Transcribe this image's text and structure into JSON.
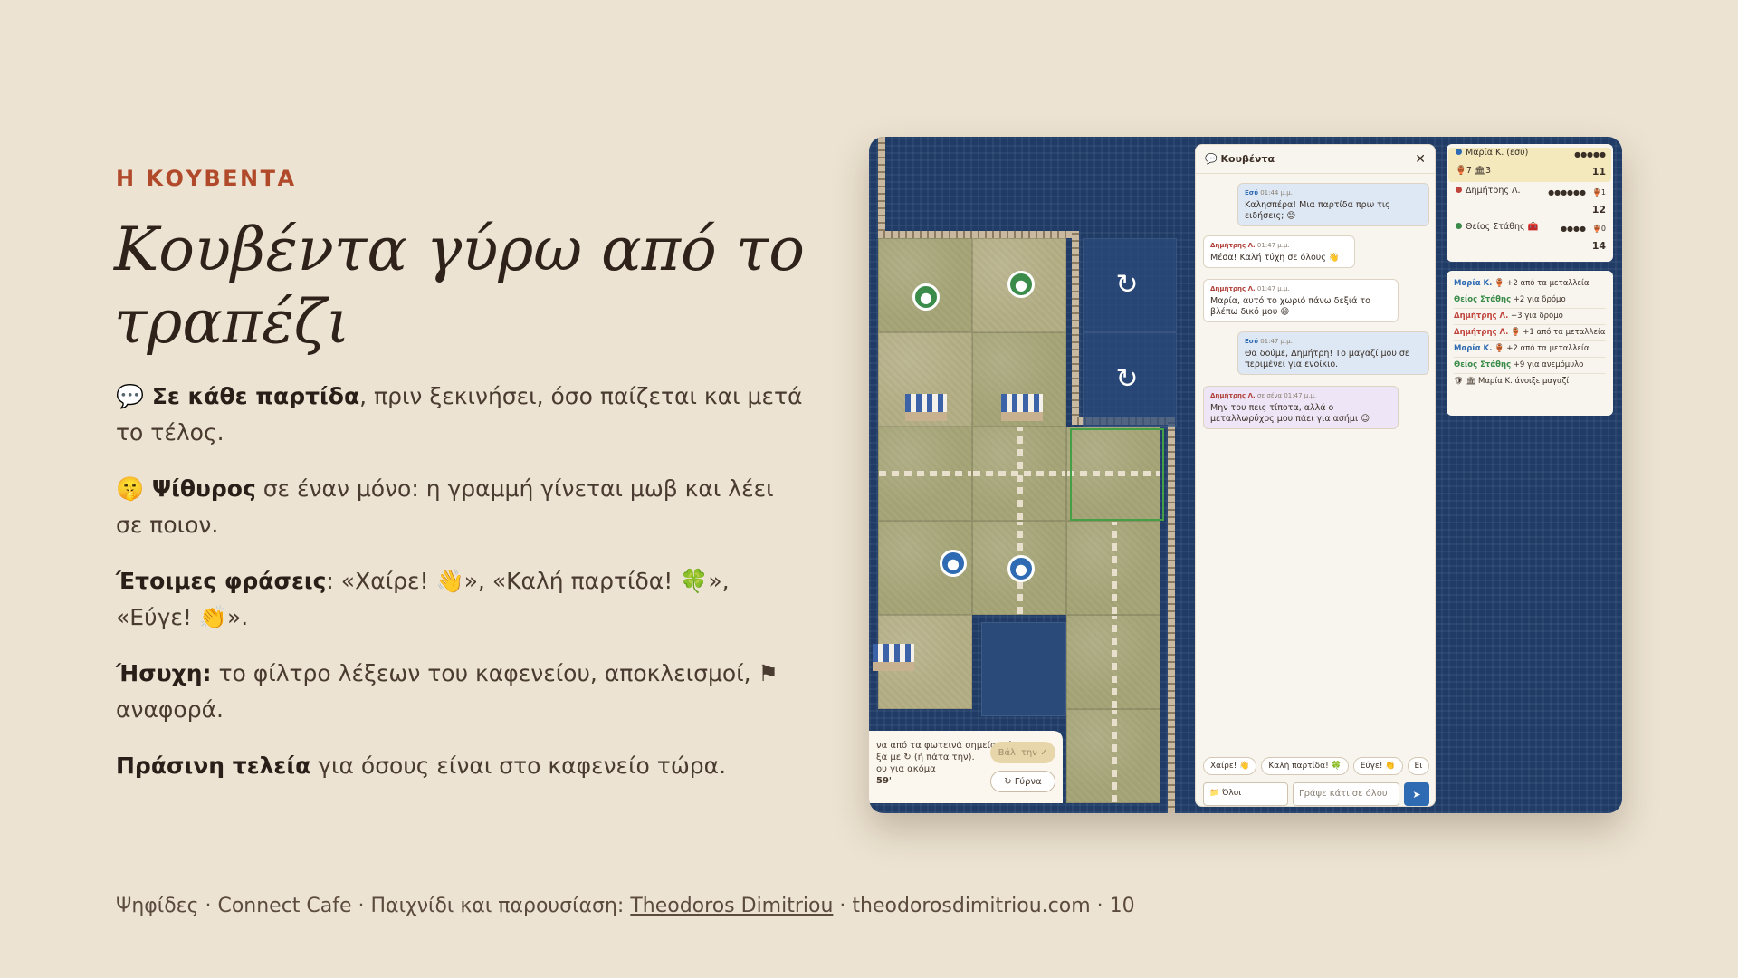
{
  "slide": {
    "eyebrow": "Η ΚΟΥΒΕΝΤΑ",
    "title_line1": "Κουβέντα γύρω από το",
    "title_line2": "τραπέζι",
    "bullets": [
      {
        "bold": "💬 Σε κάθε παρτίδα",
        "text": ", πριν ξεκινήσει, όσο παίζεται και μετά το τέλος."
      },
      {
        "bold": "🤫 Ψίθυρος",
        "text": " σε έναν μόνο: η γραμμή γίνεται μωβ και λέει σε ποιον."
      },
      {
        "bold": "Έτοιμες φράσεις",
        "text": ": «Χαίρε! 👋», «Καλή παρτίδα! 🍀», «Εύγε! 👏»."
      },
      {
        "bold": "Ήσυχη:",
        "text": " το φίλτρο λέξεων του καφενείου, αποκλεισμοί, ⚑ αναφορά."
      },
      {
        "bold": "Πράσινη τελεία",
        "text": " για όσους είναι στο καφενείο τώρα."
      }
    ],
    "footer_prefix": "Ψηφίδες · Connect Cafe · Παιχνίδι και παρουσίαση: ",
    "footer_link": "Theodoros Dimitriou",
    "footer_suffix": " · theodorosdimitriou.com · 10"
  },
  "turn_popup": {
    "text_line1": "να από τα φωτεινά σημεία. Γύρνα",
    "text_line2": "ξα με ↻ (ή πάτα την).",
    "text_line3": "ου για ακόμα",
    "timer": "59'",
    "place_button": "Βάλ' την ✓",
    "rotate_button": "↻ Γύρνα"
  },
  "chat": {
    "title": "💬 Κουβέντα",
    "close": "✕",
    "messages": [
      {
        "author": "Εσύ",
        "time": "01:44 μ.μ.",
        "text": "Καλησπέρα! Μια παρτίδα πριν τις ειδήσεις; 😊"
      },
      {
        "author": "Δημήτρης Λ.",
        "time": "01:47 μ.μ.",
        "text": "Μέσα! Καλή τύχη σε όλους 👋"
      },
      {
        "author": "Δημήτρης Λ.",
        "time": "01:47 μ.μ.",
        "text": "Μαρία, αυτό το χωριό πάνω δεξιά το βλέπω δικό μου 😄"
      },
      {
        "author": "Εσύ",
        "time": "01:47 μ.μ.",
        "text": "Θα δούμε, Δημήτρη! Το μαγαζί μου σε περιμένει για ενοίκιο."
      },
      {
        "author": "Δημήτρης Λ.",
        "whisper": "σε σένα",
        "time": "01:47 μ.μ.",
        "text": "Μην του πεις τίποτα, αλλά ο μεταλλωρύχος μου πάει για ασήμι 😉"
      }
    ],
    "quick_phrases": [
      "Χαίρε! 👋",
      "Καλή παρτίδα! 🍀",
      "Εύγε! 👏",
      "Ει"
    ],
    "recipient": "📁 Όλοι",
    "input_placeholder": "Γράψε κάτι σε όλου",
    "send": "➤"
  },
  "scoreboard": [
    {
      "name": "Μαρία Κ. (εσύ)",
      "stars": "●●●●●",
      "resources": "🏺7 🏛3",
      "points": "11",
      "color": "#2f6bb2"
    },
    {
      "name": "Δημήτρης Λ.",
      "stars": "●●●●●●",
      "resources": "🏺1",
      "points": "12",
      "color": "#c0443c"
    },
    {
      "name": "Θείος Στάθης 🧰",
      "stars": "●●●●",
      "resources": "🏺0",
      "points": "14",
      "color": "#3b8c4a"
    }
  ],
  "log": [
    {
      "who": "Μαρία Κ.",
      "what": " 🏺 +2 από τα μεταλλεία",
      "color": "#2f6bb2"
    },
    {
      "who": "Θείος Στάθης",
      "what": " +2 για δρόμο",
      "color": "#3b8c4a"
    },
    {
      "who": "Δημήτρης Λ.",
      "what": " +3 για δρόμο",
      "color": "#c0443c"
    },
    {
      "who": "Δημήτρης Λ.",
      "what": " 🏺 +1 από τα μεταλλεία",
      "color": "#c0443c"
    },
    {
      "who": "Μαρία Κ.",
      "what": " 🏺 +2 από τα μεταλλεία",
      "color": "#2f6bb2"
    },
    {
      "who": "Θείος Στάθης",
      "what": " +9 για ανεμόμυλο",
      "color": "#3b8c4a"
    },
    {
      "who": "",
      "what": "🛡 🏛 Μαρία Κ. άνοιξε μαγαζί",
      "color": "#3a2f27"
    }
  ],
  "colors": {
    "accent": "#b04a2a",
    "background": "#ede3d2",
    "board_blue": "#1f3b66"
  }
}
